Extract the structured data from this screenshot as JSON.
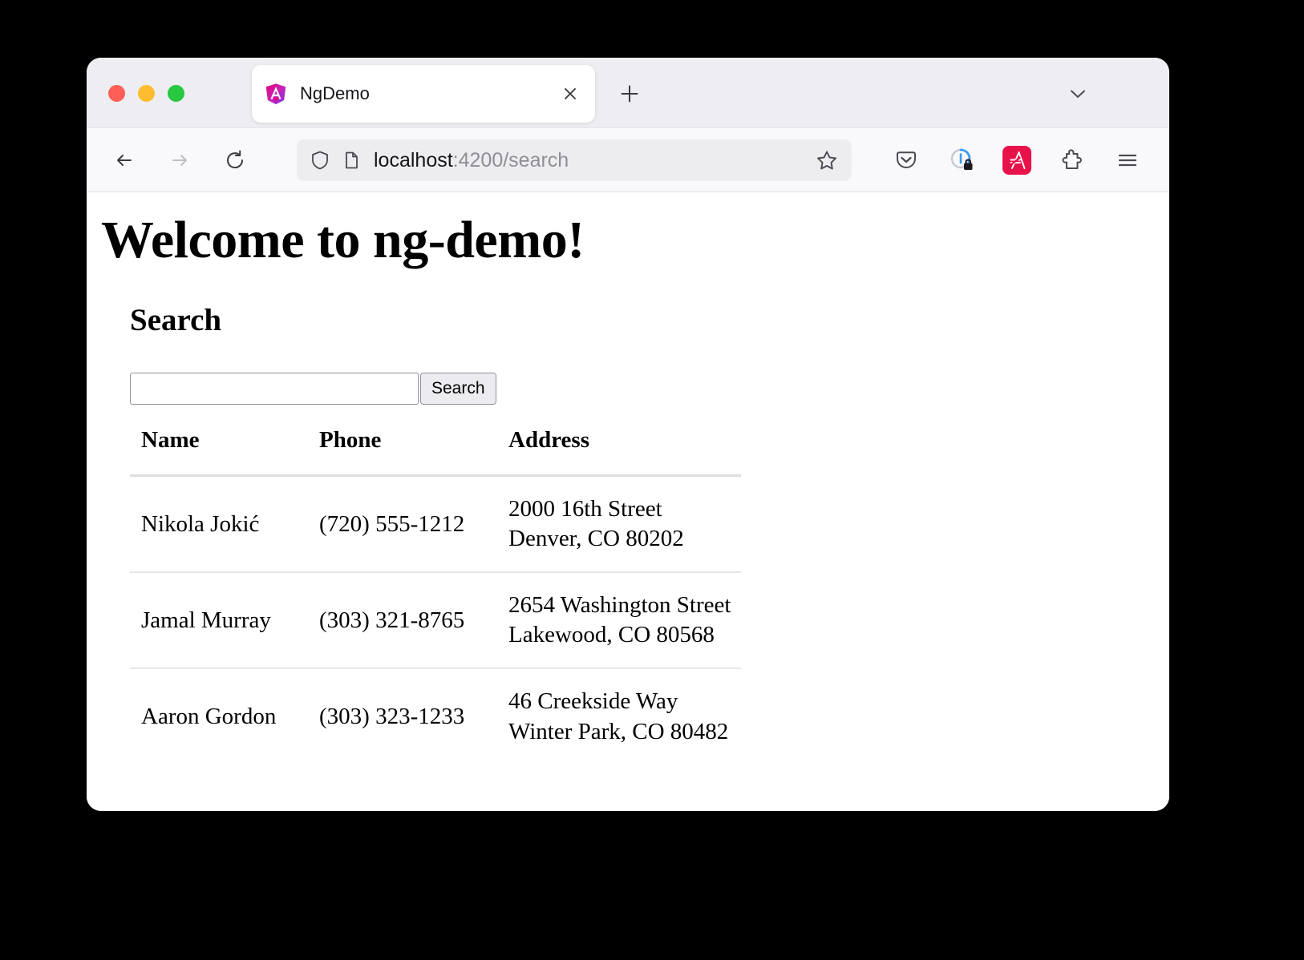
{
  "browser": {
    "traffic_lights": [
      "close",
      "minimize",
      "maximize"
    ],
    "tab": {
      "title": "NgDemo",
      "favicon": "angular-logo-icon",
      "close_label": "✕"
    },
    "new_tab_label": "+",
    "tab_list_chevron": "chevron-down-icon",
    "nav": {
      "back": "back-arrow-icon",
      "forward": "forward-arrow-icon",
      "reload": "reload-icon"
    },
    "url": {
      "host": "localhost",
      "rest": ":4200/search",
      "full": "localhost:4200/search",
      "shield_icon": "shield-icon",
      "page_icon": "page-document-icon",
      "bookmark_icon": "bookmark-star-icon"
    },
    "toolbar_icons": [
      "pocket-icon",
      "privacy-badger-icon",
      "app-extension-icon",
      "puzzle-extension-icon",
      "hamburger-menu-icon"
    ],
    "app_icon_color": "#e8124a"
  },
  "page": {
    "heading": "Welcome to ng-demo!",
    "section_heading": "Search",
    "search": {
      "value": "",
      "placeholder": "",
      "button_label": "Search"
    },
    "table": {
      "columns": [
        "Name",
        "Phone",
        "Address"
      ],
      "rows": [
        {
          "name": "Nikola Jokić",
          "phone": "(720) 555-1212",
          "address_line1": "2000 16th Street",
          "address_line2": "Denver, CO 80202"
        },
        {
          "name": "Jamal Murray",
          "phone": "(303) 321-8765",
          "address_line1": "2654 Washington Street",
          "address_line2": "Lakewood, CO 80568"
        },
        {
          "name": "Aaron Gordon",
          "phone": "(303) 323-1233",
          "address_line1": "46 Creekside Way",
          "address_line2": "Winter Park, CO 80482"
        }
      ]
    }
  }
}
